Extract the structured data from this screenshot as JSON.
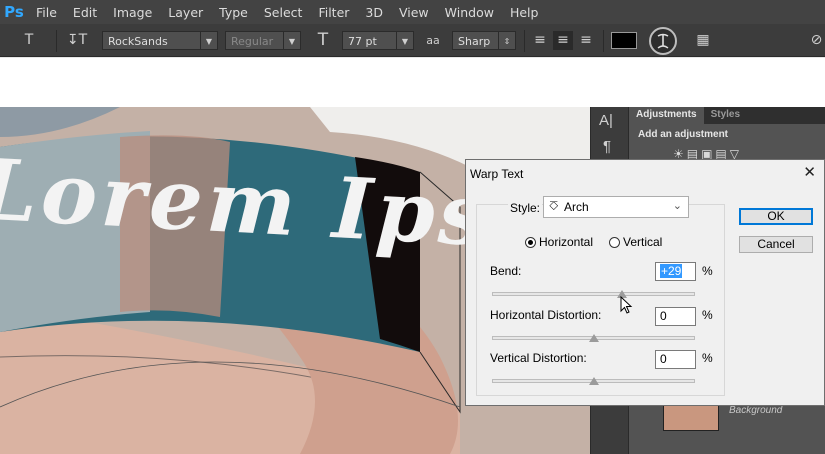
{
  "app": {
    "logo": "Ps"
  },
  "menu": [
    "File",
    "Edit",
    "Image",
    "Layer",
    "Type",
    "Select",
    "Filter",
    "3D",
    "View",
    "Window",
    "Help"
  ],
  "options": {
    "font_family": "RockSands",
    "font_style": "Regular",
    "font_size": "77 pt",
    "aa_icon_text": "aa",
    "antialias": "Sharp",
    "text_color": "#000000"
  },
  "canvas": {
    "text": "Lorem Ipsum"
  },
  "adjustments_panel": {
    "tabs": [
      "Adjustments",
      "Styles"
    ],
    "heading": "Add an adjustment",
    "layer_name": "Background"
  },
  "dialog": {
    "title": "Warp Text",
    "style_label": "Style:",
    "style_value": "Arch",
    "orientation": {
      "horizontal": "Horizontal",
      "vertical": "Vertical",
      "selected": "horizontal"
    },
    "bend": {
      "label": "Bend:",
      "value": "+29",
      "unit": "%",
      "level": 29
    },
    "h_distortion": {
      "label": "Horizontal Distortion:",
      "value": "0",
      "unit": "%",
      "level": 0
    },
    "v_distortion": {
      "label": "Vertical Distortion:",
      "value": "0",
      "unit": "%",
      "level": 0
    },
    "ok_label": "OK",
    "cancel_label": "Cancel"
  },
  "colors": {
    "ps_blue": "#31a8ff",
    "selection_blue": "#3399ff",
    "dialog_bg": "#f0f0f0"
  }
}
